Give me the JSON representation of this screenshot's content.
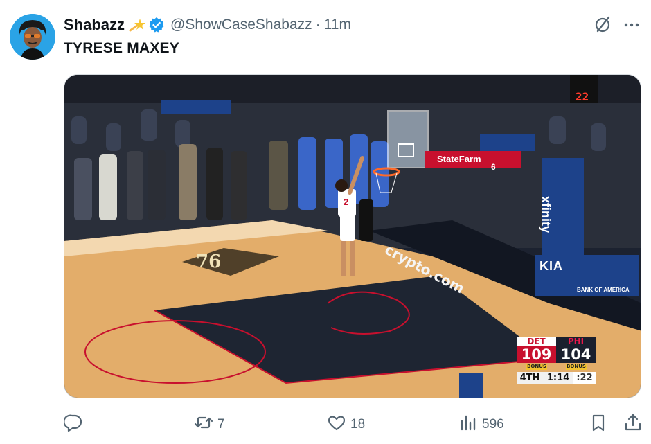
{
  "author": {
    "name": "Shabazz",
    "handle": "@ShowCaseShabazz",
    "separator": "·",
    "time": "11m",
    "verified": true,
    "emoji_icon": "shooting-star-emoji"
  },
  "tweet": {
    "text": "TYRESE MAXEY"
  },
  "media": {
    "scoreboard": {
      "home_team": "DET",
      "away_team": "PHI",
      "home_score": "109",
      "away_score": "104",
      "home_bonus": "BONUS",
      "away_bonus": "BONUS",
      "quarter": "4TH",
      "clock": "1:14",
      "shot_clock": ":22"
    },
    "player_number": "2",
    "bench_number": "6",
    "court_text": "crypto.com",
    "sponsor_xfinity": "xfinity",
    "sponsor_kia": "KIA",
    "sponsor_boa": "BANK OF AMERICA",
    "sponsor_statefarm": "StateFarm",
    "shot_clock_display": "22",
    "colors": {
      "court": "#e3ad6a",
      "paint": "#1e2532",
      "accent_red": "#c8102e",
      "sixers_blue": "#1d428a"
    }
  },
  "actions": {
    "reply_count": "",
    "retweet_count": "7",
    "like_count": "18",
    "views_count": "596"
  },
  "colors": {
    "verified_blue": "#1d9bf0",
    "text_secondary": "#536471"
  }
}
